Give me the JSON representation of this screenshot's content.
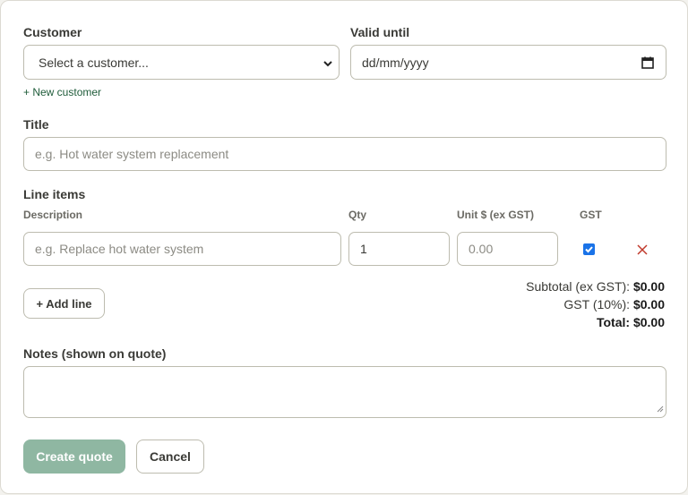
{
  "customer": {
    "label": "Customer",
    "select_value": "Select a customer...",
    "new_link": "+ New customer"
  },
  "valid_until": {
    "label": "Valid until",
    "value": "dd/mm/yyyy"
  },
  "title": {
    "label": "Title",
    "placeholder": "e.g. Hot water system replacement"
  },
  "line_items": {
    "label": "Line items",
    "columns": [
      "Description",
      "Qty",
      "Unit $ (ex GST)",
      "GST"
    ],
    "row": {
      "description_placeholder": "e.g. Replace hot water system",
      "qty": "1",
      "unit_placeholder": "0.00",
      "gst_checked": true
    },
    "add_line": "+ Add line"
  },
  "totals": {
    "subtotal_label": "Subtotal (ex GST):",
    "subtotal": "$0.00",
    "gst_label": "GST (10%):",
    "gst": "$0.00",
    "total_label": "Total:",
    "total": "$0.00"
  },
  "notes": {
    "label": "Notes (shown on quote)"
  },
  "actions": {
    "create": "Create quote",
    "cancel": "Cancel"
  },
  "colors": {
    "accent": "#1f5c3a",
    "primary_button": "#8fb7a2",
    "remove": "#c0392b",
    "checkbox": "#1a73e8"
  }
}
